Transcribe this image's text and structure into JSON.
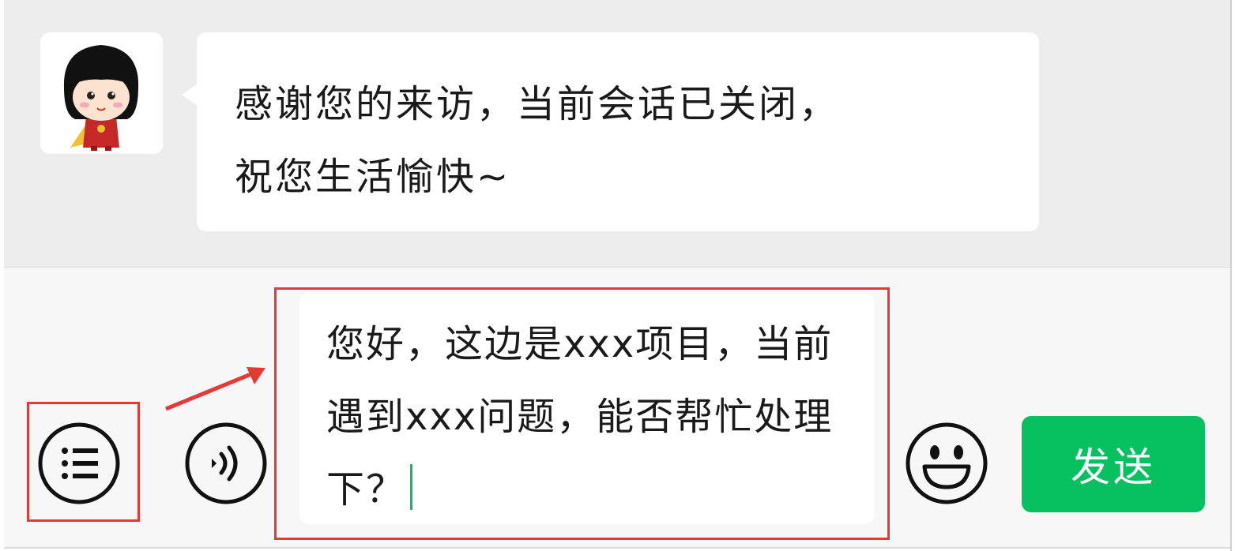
{
  "chat": {
    "messages": [
      {
        "sender": "agent",
        "avatar_icon": "cartoon-girl-avatar-icon",
        "line1": "感谢您的来访，当前会话已关闭，",
        "line2": "祝您生活愉快~"
      }
    ]
  },
  "input_bar": {
    "menu_icon": "list-menu-icon",
    "voice_icon": "voice-input-icon",
    "emoji_icon": "smiley-emoji-icon",
    "input_value": "您好，这边是xxx项目，当前遇到xxx问题，能否帮忙处理下？",
    "send_label": "发送"
  },
  "colors": {
    "chat_background": "#ededed",
    "input_bar_background": "#f7f7f7",
    "send_button": "#07c160",
    "highlight": "#e53935"
  }
}
